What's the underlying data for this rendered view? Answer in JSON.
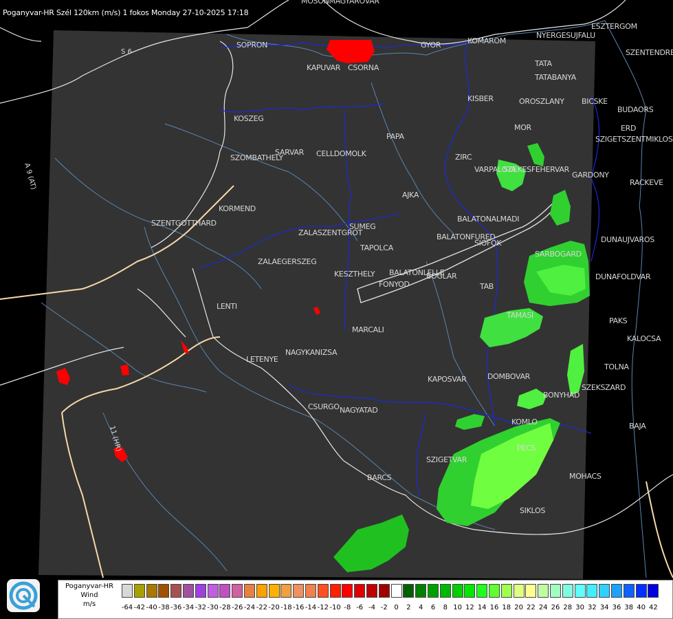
{
  "header": "Poganyvar-HR Szél 120km (m/s) 1 fokos Monday 27-10-2025 17:18",
  "cities": [
    {
      "name": "MOSONMAGYAROVAR"
    },
    {
      "name": "SOPRON"
    },
    {
      "name": "KAPUVAR"
    },
    {
      "name": "CSORNA"
    },
    {
      "name": "GYOR"
    },
    {
      "name": "KOMAROM"
    },
    {
      "name": "ESZTERGOM"
    },
    {
      "name": "NYERGESUJFALU"
    },
    {
      "name": "SZENTENDRE"
    },
    {
      "name": "TATA"
    },
    {
      "name": "TATABANYA"
    },
    {
      "name": "KISBER"
    },
    {
      "name": "OROSZLANY"
    },
    {
      "name": "BICSKE"
    },
    {
      "name": "BUDAORS"
    },
    {
      "name": "MOR"
    },
    {
      "name": "ERD"
    },
    {
      "name": "SZIGETSZENTMIKLOS"
    },
    {
      "name": "KOSZEG"
    },
    {
      "name": "PAPA"
    },
    {
      "name": "SARVAR"
    },
    {
      "name": "CELLDOMOLK"
    },
    {
      "name": "SZOMBATHELY"
    },
    {
      "name": "ZIRC"
    },
    {
      "name": "VARPALOTA"
    },
    {
      "name": "SZEKESFEHERVAR"
    },
    {
      "name": "GARDONY"
    },
    {
      "name": "RACKEVE"
    },
    {
      "name": "AJKA"
    },
    {
      "name": "KORMEND"
    },
    {
      "name": "SZENTGOTTHARD"
    },
    {
      "name": "BALATONALMADI"
    },
    {
      "name": "SUMEG"
    },
    {
      "name": "ZALASZENTGROT"
    },
    {
      "name": "BALATONFURED"
    },
    {
      "name": "DUNAUJVAROS"
    },
    {
      "name": "TAPOLCA"
    },
    {
      "name": "SIOFOK"
    },
    {
      "name": "SARBOGARD"
    },
    {
      "name": "ZALAEGERSZEG"
    },
    {
      "name": "KESZTHELY"
    },
    {
      "name": "BALATONLELLE"
    },
    {
      "name": "FONYOD"
    },
    {
      "name": "BOGLAR"
    },
    {
      "name": "DUNAFOLDVAR"
    },
    {
      "name": "TAB"
    },
    {
      "name": "LENTI"
    },
    {
      "name": "TAMASI"
    },
    {
      "name": "PAKS"
    },
    {
      "name": "MARCALI"
    },
    {
      "name": "KALOCSA"
    },
    {
      "name": "LETENYE"
    },
    {
      "name": "NAGYKANIZSA"
    },
    {
      "name": "TOLNA"
    },
    {
      "name": "KAPOSVAR"
    },
    {
      "name": "DOMBOVAR"
    },
    {
      "name": "SZEKSZARD"
    },
    {
      "name": "BONYHAD"
    },
    {
      "name": "CSURGO"
    },
    {
      "name": "NAGYATAD"
    },
    {
      "name": "BAJA"
    },
    {
      "name": "KOMLO"
    },
    {
      "name": "PECS"
    },
    {
      "name": "SZIGETVAR"
    },
    {
      "name": "MOHACS"
    },
    {
      "name": "BARCS"
    },
    {
      "name": "SIKLOS"
    }
  ],
  "road_labels": [
    "S 6",
    "A 9 (AT)",
    "11 (HR)"
  ],
  "legend": {
    "title_line1": "Poganyvar-HR",
    "title_line2": "Wind",
    "title_line3": "m/s",
    "ticks": [
      "-64",
      "-42",
      "-40",
      "-38",
      "-36",
      "-34",
      "-32",
      "-30",
      "-28",
      "-26",
      "-24",
      "-22",
      "-20",
      "-18",
      "-16",
      "-14",
      "-12",
      "-10",
      "-8",
      "-6",
      "-4",
      "-2",
      "0",
      "2",
      "4",
      "6",
      "8",
      "10",
      "12",
      "14",
      "16",
      "18",
      "20",
      "22",
      "24",
      "26",
      "28",
      "30",
      "32",
      "34",
      "36",
      "38",
      "40",
      "42"
    ],
    "colors": [
      "#d8d8d8",
      "#a8a000",
      "#a87800",
      "#a05000",
      "#a85050",
      "#a050a0",
      "#a040e0",
      "#c060e0",
      "#c050c0",
      "#d060a0",
      "#e88040",
      "#ffa000",
      "#ffb000",
      "#f0a040",
      "#f09060",
      "#f08050",
      "#ff5020",
      "#ff2000",
      "#ff0000",
      "#e00000",
      "#c00000",
      "#a00000",
      "#ffffff",
      "#006000",
      "#008000",
      "#00a000",
      "#00b800",
      "#00d000",
      "#00e800",
      "#20ff20",
      "#60ff30",
      "#a0ff50",
      "#e0ff80",
      "#ffff90",
      "#c0ffa0",
      "#a0ffc0",
      "#80ffe0",
      "#60ffff",
      "#40f0ff",
      "#30d0ff",
      "#20a0ff",
      "#1060ff",
      "#0030ff",
      "#0000e0"
    ]
  }
}
